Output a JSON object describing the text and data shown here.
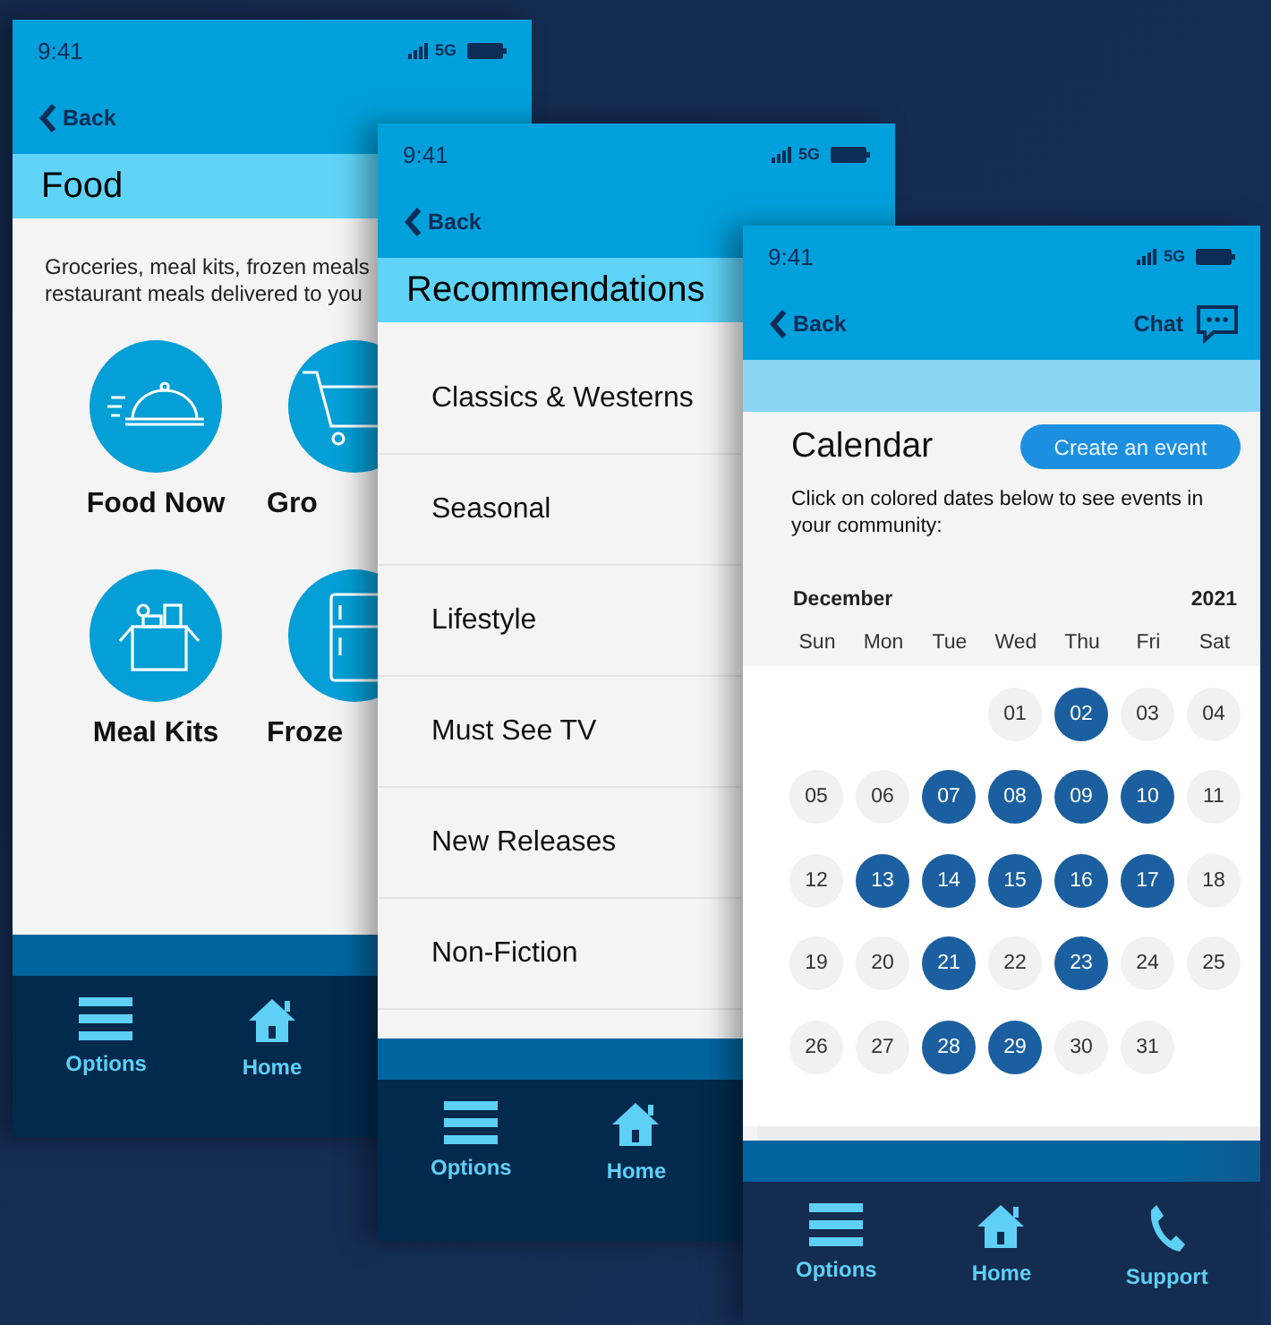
{
  "screens": [
    {
      "kind": "category_grid",
      "time": "9:41",
      "network": "5G",
      "back": "Back",
      "title": "Food",
      "description": "Groceries, meal kits, frozen meals\nrestaurant meals delivered to you",
      "categories": [
        {
          "label": "Food Now",
          "kind": "cloche"
        },
        {
          "label": "Gro",
          "kind": "cart"
        },
        {
          "label": "Meal Kits",
          "kind": "box"
        },
        {
          "label": "Froze",
          "kind": "fridge"
        }
      ],
      "nav": [
        {
          "label": "Options",
          "kind": "menu"
        },
        {
          "label": "Home",
          "kind": "home"
        }
      ]
    },
    {
      "kind": "list",
      "time": "9:41",
      "network": "5G",
      "back": "Back",
      "title": "Recommendations",
      "items": [
        "Classics & Westerns",
        "Seasonal",
        "Lifestyle",
        "Must See TV",
        "New Releases",
        "Non-Fiction"
      ],
      "nav": [
        {
          "label": "Options",
          "kind": "menu"
        },
        {
          "label": "Home",
          "kind": "home"
        }
      ]
    },
    {
      "kind": "calendar",
      "time": "9:41",
      "network": "5G",
      "back": "Back",
      "chat": "Chat",
      "title": "Calendar",
      "action": "Create an event",
      "description": "Click on colored dates below to see events in your community:",
      "month": "December",
      "year": "2021",
      "weekdays": [
        "Sun",
        "Mon",
        "Tue",
        "Wed",
        "Thu",
        "Fri",
        "Sat"
      ],
      "weeks": [
        {
          "days": [
            {
              "day": "01",
              "event": false
            },
            {
              "day": "02",
              "event": true
            },
            {
              "day": "03",
              "event": false
            },
            {
              "day": "04",
              "event": false
            }
          ]
        },
        {
          "days": [
            {
              "day": "05",
              "event": false
            },
            {
              "day": "06",
              "event": false
            },
            {
              "day": "07",
              "event": true
            },
            {
              "day": "08",
              "event": true
            },
            {
              "day": "09",
              "event": true
            },
            {
              "day": "10",
              "event": true
            },
            {
              "day": "11",
              "event": false
            }
          ]
        },
        {
          "days": [
            {
              "day": "12",
              "event": false
            },
            {
              "day": "13",
              "event": true
            },
            {
              "day": "14",
              "event": true
            },
            {
              "day": "15",
              "event": true
            },
            {
              "day": "16",
              "event": true
            },
            {
              "day": "17",
              "event": true
            },
            {
              "day": "18",
              "event": false
            }
          ]
        },
        {
          "days": [
            {
              "day": "19",
              "event": false
            },
            {
              "day": "20",
              "event": false
            },
            {
              "day": "21",
              "event": true
            },
            {
              "day": "22",
              "event": false
            },
            {
              "day": "23",
              "event": true
            },
            {
              "day": "24",
              "event": false
            },
            {
              "day": "25",
              "event": false
            }
          ]
        },
        {
          "days": [
            {
              "day": "26",
              "event": false
            },
            {
              "day": "27",
              "event": false
            },
            {
              "day": "28",
              "event": true
            },
            {
              "day": "29",
              "event": true
            },
            {
              "day": "30",
              "event": false
            },
            {
              "day": "31",
              "event": false
            }
          ]
        }
      ],
      "nav": [
        {
          "label": "Options",
          "kind": "menu"
        },
        {
          "label": "Home",
          "kind": "home"
        },
        {
          "label": "Support",
          "kind": "phone"
        }
      ]
    }
  ]
}
